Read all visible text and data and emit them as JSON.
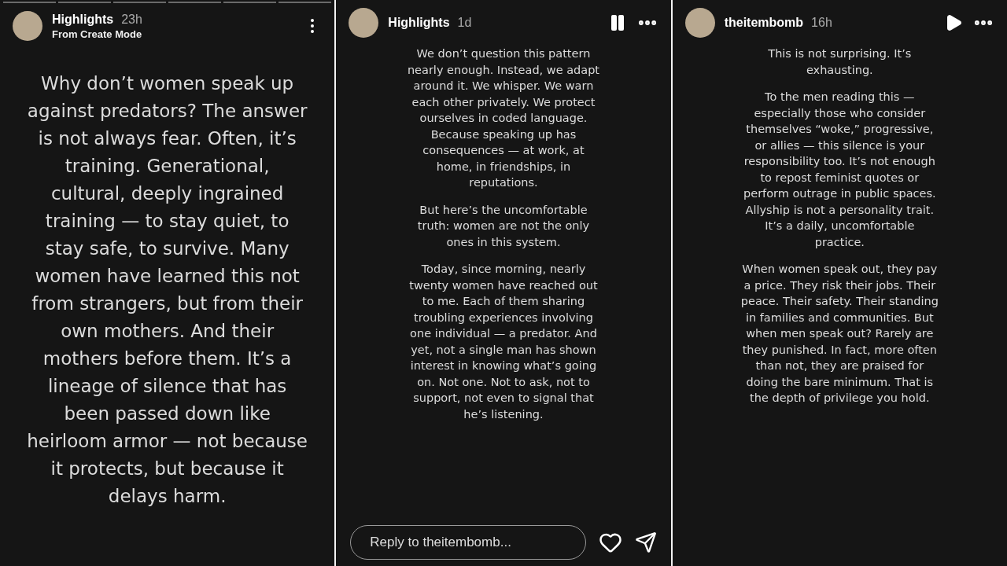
{
  "stories": [
    {
      "kind": "large-text",
      "account": "Highlights",
      "time": "23h",
      "subtitle": "From Create Mode",
      "menu": {
        "kind": "vertical"
      },
      "progress": [
        {
          "level": 1
        },
        {
          "level": 1
        },
        {
          "level": 1
        },
        {
          "level": 1
        },
        {
          "level": 1
        },
        {
          "level": 1
        }
      ],
      "paragraphs": [
        "Why don’t women speak up against predators? The answer is not always fear. Often, it’s training. Generational, cultural, deeply ingrained training — to stay quiet, to stay safe, to survive. Many women have learned this not from strangers, but from their own mothers. And their mothers before them. It’s a lineage of silence that has been passed down like heirloom armor — not because it protects, but because it delays harm."
      ]
    },
    {
      "kind": "small-text",
      "account": "Highlights",
      "time": "1d",
      "menu": {
        "kind": "horizontal"
      },
      "paused": false,
      "paragraphs": [
        "We don’t question this pattern nearly enough. Instead, we adapt around it. We whisper. We warn each other privately. We protect ourselves in coded language. Because speaking up has consequences — at work, at home, in friendships, in reputations.",
        "But here’s the uncomfortable truth: women are not the only ones in this system.",
        "Today, since morning, nearly twenty women have reached out to me. Each of them sharing troubling experiences involving one individual — a predator. And yet, not a single man has shown interest in knowing what’s going on. Not one. Not to ask, not to support, not even to signal that he’s listening."
      ],
      "reply": {
        "placeholder": "Reply to theitembomb..."
      }
    },
    {
      "kind": "small-text",
      "account": "theitembomb",
      "time": "16h",
      "menu": {
        "kind": "horizontal"
      },
      "paused": true,
      "paragraphs": [
        "This is not surprising. It’s exhausting.",
        "To the men reading this — especially those who consider themselves “woke,” progressive, or allies — this silence is your responsibility too. It’s not enough to repost feminist quotes or perform outrage in public spaces. Allyship is not a personality trait. It’s a daily, uncomfortable practice.",
        "When women speak out, they pay a price. They risk their jobs. Their peace. Their safety. Their standing in families and communities. But when men speak out? Rarely are they punished. In fact, more often than not, they are praised for doing the bare minimum. That is the depth of privilege you hold."
      ]
    }
  ]
}
